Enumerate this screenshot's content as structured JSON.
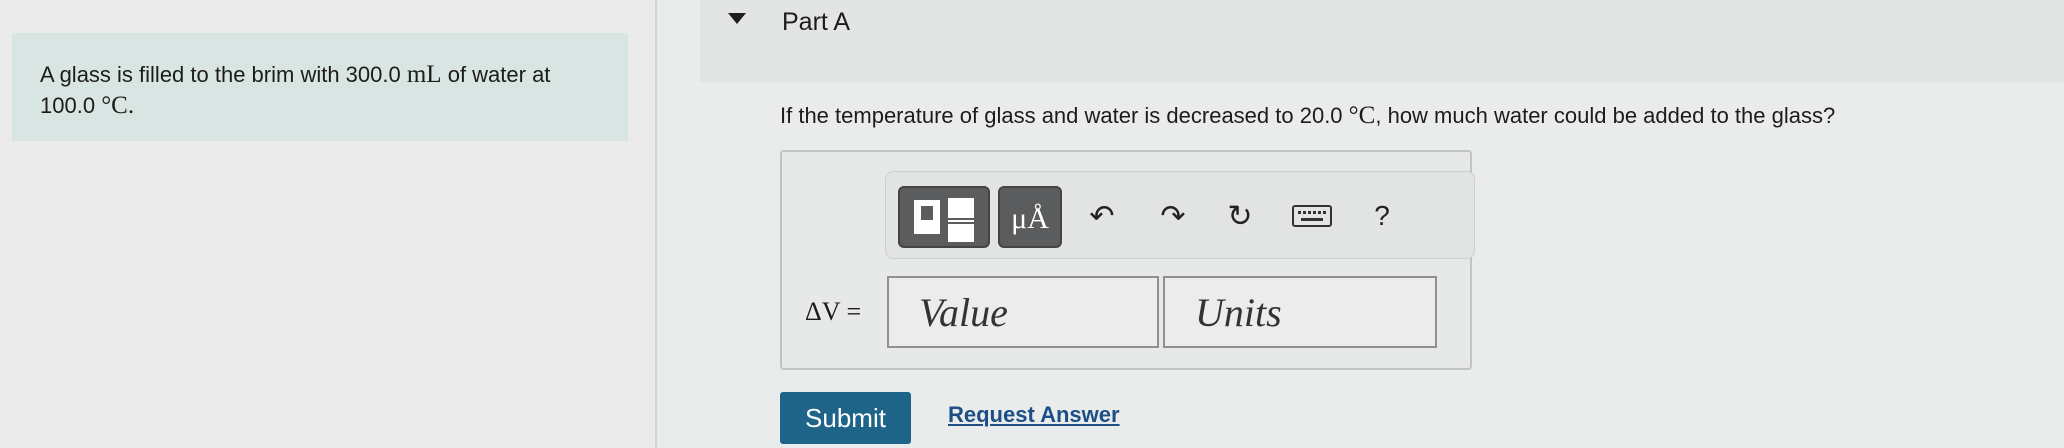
{
  "problem": {
    "text_before": "A glass is filled to the brim with 300.0",
    "volume_unit": "mL",
    "text_middle": "of water at 100.0",
    "temp_unit": "°C."
  },
  "part": {
    "title": "Part A",
    "question_before": "If the temperature of glass and water is decreased to 20.0",
    "question_unit": "°C",
    "question_after": ", how much water could be added to the glass?"
  },
  "toolbar": {
    "units_glyph": "μÅ",
    "undo_glyph": "↶",
    "redo_glyph": "↷",
    "reset_glyph": "↻",
    "help_glyph": "?",
    "icons": [
      "templates-icon",
      "units-icon",
      "undo-icon",
      "redo-icon",
      "reset-icon",
      "keyboard-icon",
      "help-icon"
    ]
  },
  "answer": {
    "variable_label": "ΔV =",
    "value_placeholder": "Value",
    "units_placeholder": "Units"
  },
  "actions": {
    "submit_label": "Submit",
    "request_answer_label": "Request Answer"
  },
  "colors": {
    "problem_bg": "#d9e5e3",
    "submit_bg": "#1d6488",
    "link": "#1d4f86"
  }
}
